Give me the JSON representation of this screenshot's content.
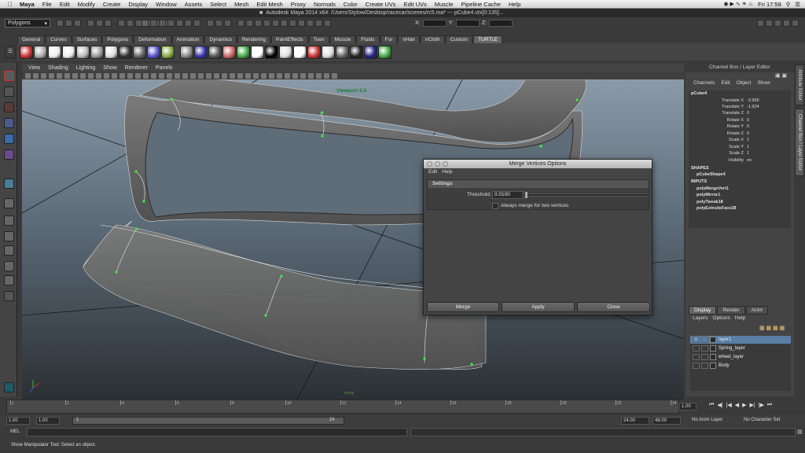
{
  "macmenu": {
    "app": "Maya",
    "items": [
      "File",
      "Edit",
      "Modify",
      "Create",
      "Display",
      "Window",
      "Assets",
      "Select",
      "Mesh",
      "Edit Mesh",
      "Proxy",
      "Normals",
      "Color",
      "Create UVs",
      "Edit UVs",
      "Muscle",
      "Pipeline Cache",
      "Help"
    ],
    "clock": "Fri 17:58"
  },
  "title": {
    "text": "Autodesk Maya 2014 x64: /Users/Stylow/Desktop/racecar/scenes/rc5.ma*   ---   pCube4.vtx[0:135]...",
    "x_label": "X:",
    "y_label": "Y:",
    "z_label": "Z:"
  },
  "menuset": "Polygons",
  "shelf_tabs": [
    "General",
    "Curves",
    "Surfaces",
    "Polygons",
    "Deformation",
    "Animation",
    "Dynamics",
    "Rendering",
    "PaintEffects",
    "Toon",
    "Muscle",
    "Fluids",
    "Fur",
    "nHair",
    "nCloth",
    "Custom",
    "TURTLE"
  ],
  "viewport": {
    "menu": [
      "View",
      "Shading",
      "Lighting",
      "Show",
      "Renderer",
      "Panels"
    ],
    "label": "Viewport 2.0",
    "camera": "persp"
  },
  "channel_box": {
    "title": "Channel Box / Layer Editor",
    "menu": [
      "Channels",
      "Edit",
      "Object",
      "Show"
    ],
    "object": "pCube4",
    "attributes": [
      {
        "name": "Translate X",
        "value": "-3.959"
      },
      {
        "name": "Translate Y",
        "value": "-1.924"
      },
      {
        "name": "Translate Z",
        "value": "0"
      },
      {
        "name": "Rotate X",
        "value": "0"
      },
      {
        "name": "Rotate Y",
        "value": "0"
      },
      {
        "name": "Rotate Z",
        "value": "0"
      },
      {
        "name": "Scale X",
        "value": "1"
      },
      {
        "name": "Scale Y",
        "value": "1"
      },
      {
        "name": "Scale Z",
        "value": "1"
      },
      {
        "name": "Visibility",
        "value": "on"
      }
    ],
    "shapes_label": "SHAPES",
    "shape": "pCubeShape4",
    "inputs_label": "INPUTS",
    "inputs": [
      "polyMergeVert1",
      "polyMirror1",
      "polyTweak18",
      "polyExtrudeFace28"
    ]
  },
  "side_tabs": [
    "Attribute Editor",
    "Channel Box / Layer Editor"
  ],
  "layer_editor": {
    "tabs": [
      "Display",
      "Render",
      "Anim"
    ],
    "menu": [
      "Layers",
      "Options",
      "Help"
    ],
    "layers": [
      {
        "v": "V",
        "name": "layer1"
      },
      {
        "v": "",
        "name": "Spring_layer"
      },
      {
        "v": "",
        "name": "wheel_layer"
      },
      {
        "v": "",
        "name": "Body"
      }
    ]
  },
  "dialog": {
    "title": "Merge Vertices Options",
    "menu": [
      "Edit",
      "Help"
    ],
    "settings_label": "Settings",
    "threshold_label": "Threshold:",
    "threshold_value": "0.0100",
    "checkbox_label": "Always merge for two vertices",
    "checkbox_checked": false,
    "buttons": [
      "Merge",
      "Apply",
      "Close"
    ]
  },
  "timeline": {
    "ticks": [
      "1",
      "2",
      "4",
      "6",
      "8",
      "10",
      "12",
      "14",
      "16",
      "18",
      "20",
      "22",
      "24"
    ],
    "current_frame": "1.00",
    "start": "1.00",
    "start2": "1.00",
    "range_start": "1",
    "range_end": "24",
    "end": "24.00",
    "end2": "48.00",
    "anim_layer": "No Anim Layer",
    "character_set": "No Character Set"
  },
  "command": {
    "mel_label": "MEL"
  },
  "help_line": "Show Manipulator Tool: Select an object."
}
